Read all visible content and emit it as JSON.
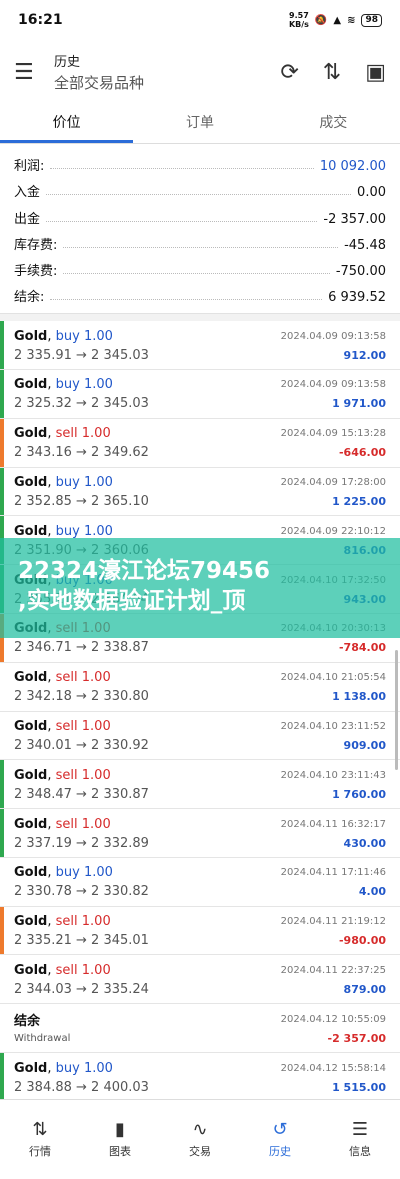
{
  "status": {
    "time": "16:21",
    "net_speed": "9.57",
    "net_unit": "KB/s",
    "battery": "98"
  },
  "header": {
    "title": "历史",
    "subtitle": "全部交易品种"
  },
  "tabs": [
    "价位",
    "订单",
    "成交"
  ],
  "summary": [
    {
      "label": "利润:",
      "value": "10 092.00",
      "highlight": true
    },
    {
      "label": "入金",
      "value": "0.00",
      "highlight": false
    },
    {
      "label": "出金",
      "value": "-2 357.00",
      "highlight": false
    },
    {
      "label": "库存费:",
      "value": "-45.48",
      "highlight": false
    },
    {
      "label": "手续费:",
      "value": "-750.00",
      "highlight": false
    },
    {
      "label": "结余:",
      "value": "6 939.52",
      "highlight": false
    }
  ],
  "trades": [
    {
      "symbol": "Gold",
      "side": "buy",
      "lot": "1.00",
      "prices": "2 335.91 → 2 345.03",
      "time": "2024.04.09 09:13:58",
      "amount": "912.00",
      "bar": "green"
    },
    {
      "symbol": "Gold",
      "side": "buy",
      "lot": "1.00",
      "prices": "2 325.32 → 2 345.03",
      "time": "2024.04.09 09:13:58",
      "amount": "1 971.00",
      "bar": "green"
    },
    {
      "symbol": "Gold",
      "side": "sell",
      "lot": "1.00",
      "prices": "2 343.16 → 2 349.62",
      "time": "2024.04.09 15:13:28",
      "amount": "-646.00",
      "bar": "orange"
    },
    {
      "symbol": "Gold",
      "side": "buy",
      "lot": "1.00",
      "prices": "2 352.85 → 2 365.10",
      "time": "2024.04.09 17:28:00",
      "amount": "1 225.00",
      "bar": "green"
    },
    {
      "symbol": "Gold",
      "side": "buy",
      "lot": "1.00",
      "prices": "2 351.90 → 2 360.06",
      "time": "2024.04.09 22:10:12",
      "amount": "816.00",
      "bar": "green"
    },
    {
      "symbol": "Gold",
      "side": "buy",
      "lot": "1.00",
      "prices": "2 355.21 → 2 364.64",
      "time": "2024.04.10 17:32:50",
      "amount": "943.00",
      "bar": "green"
    },
    {
      "symbol": "Gold",
      "side": "sell",
      "lot": "1.00",
      "prices": "2 346.71 → 2 338.87",
      "time": "2024.04.10 20:30:13",
      "amount": "-784.00",
      "bar": "orange"
    },
    {
      "symbol": "Gold",
      "side": "sell",
      "lot": "1.00",
      "prices": "2 342.18 → 2 330.80",
      "time": "2024.04.10 21:05:54",
      "amount": "1 138.00",
      "bar": "none"
    },
    {
      "symbol": "Gold",
      "side": "sell",
      "lot": "1.00",
      "prices": "2 340.01 → 2 330.92",
      "time": "2024.04.10 23:11:52",
      "amount": "909.00",
      "bar": "none"
    },
    {
      "symbol": "Gold",
      "side": "sell",
      "lot": "1.00",
      "prices": "2 348.47 → 2 330.87",
      "time": "2024.04.10 23:11:43",
      "amount": "1 760.00",
      "bar": "green"
    },
    {
      "symbol": "Gold",
      "side": "sell",
      "lot": "1.00",
      "prices": "2 337.19 → 2 332.89",
      "time": "2024.04.11 16:32:17",
      "amount": "430.00",
      "bar": "green"
    },
    {
      "symbol": "Gold",
      "side": "buy",
      "lot": "1.00",
      "prices": "2 330.78 → 2 330.82",
      "time": "2024.04.11 17:11:46",
      "amount": "4.00",
      "bar": "none"
    },
    {
      "symbol": "Gold",
      "side": "sell",
      "lot": "1.00",
      "prices": "2 335.21 → 2 345.01",
      "time": "2024.04.11 21:19:12",
      "amount": "-980.00",
      "bar": "orange"
    },
    {
      "symbol": "Gold",
      "side": "sell",
      "lot": "1.00",
      "prices": "2 344.03 → 2 335.24",
      "time": "2024.04.11 22:37:25",
      "amount": "879.00",
      "bar": "none"
    },
    {
      "symbol": "结余",
      "side": "",
      "lot": "",
      "prices": "Withdrawal",
      "time": "2024.04.12 10:55:09",
      "amount": "-2 357.00",
      "bar": "none"
    },
    {
      "symbol": "Gold",
      "side": "buy",
      "lot": "1.00",
      "prices": "2 384.88 → 2 400.03",
      "time": "2024.04.12 15:58:14",
      "amount": "1 515.00",
      "bar": "green"
    }
  ],
  "watermark": {
    "line1": "22324濠江论坛79456",
    "line2": ",实地数据验证计划_顶"
  },
  "nav": [
    {
      "label": "行情",
      "icon": "⇅",
      "active": false
    },
    {
      "label": "图表",
      "icon": "▮",
      "active": false
    },
    {
      "label": "交易",
      "icon": "∿",
      "active": false
    },
    {
      "label": "历史",
      "icon": "↺",
      "active": true
    },
    {
      "label": "信息",
      "icon": "☰",
      "active": false
    }
  ]
}
